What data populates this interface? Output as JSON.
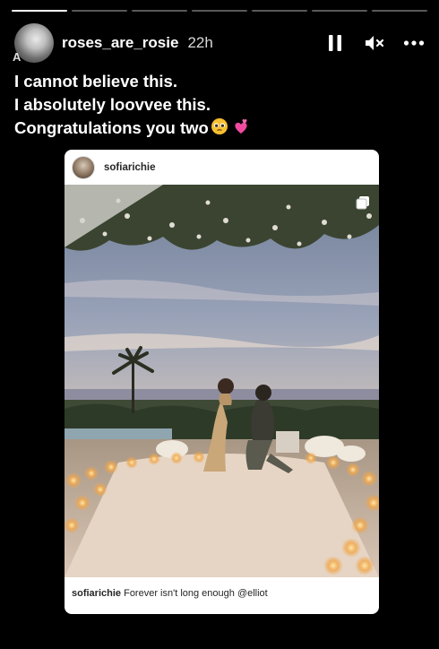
{
  "story": {
    "progress_segments": 7,
    "progress_done": 1,
    "username": "roses_are_rosie",
    "time_ago": "22h",
    "avatar_overlay_text": "A",
    "caption_lines": [
      "I cannot believe this.",
      "I absolutely loovvee this.",
      "Congratulations you two"
    ],
    "caption_emojis": [
      "pleading-face-emoji",
      "two-hearts-emoji"
    ]
  },
  "controls": {
    "pause_icon": "pause-icon",
    "mute_icon": "speaker-muted-icon",
    "more_icon": "more-dots-icon"
  },
  "post": {
    "username": "sofiarichie",
    "caption_user": "sofiarichie",
    "caption_text": "Forever isn't long enough @elliot",
    "multi_image_icon": "multiple-photos-icon"
  },
  "colors": {
    "background": "#000000",
    "card": "#ffffff"
  }
}
